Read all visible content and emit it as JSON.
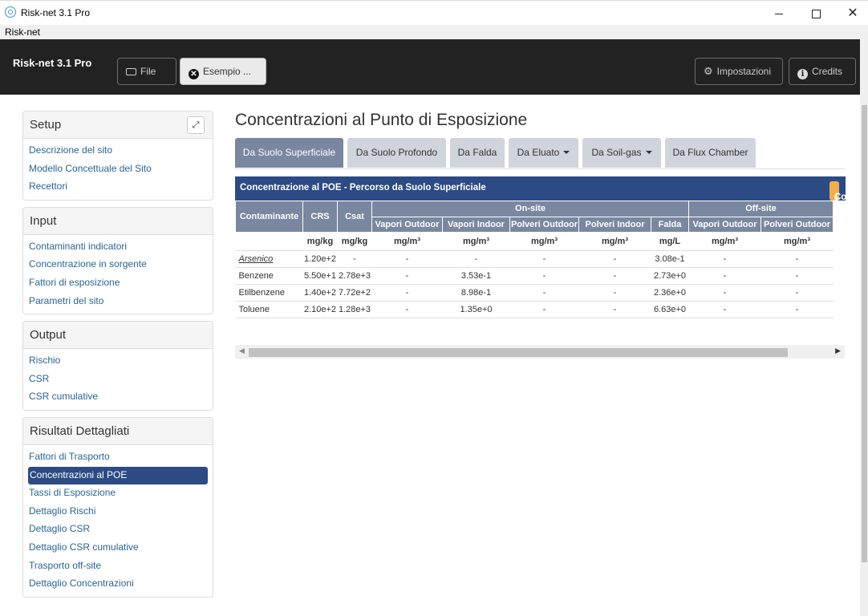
{
  "window": {
    "title": "Risk-net 3.1 Pro",
    "minimize": "—",
    "maximize": "☐",
    "close": "✕"
  },
  "menubar": {
    "label": "Risk-net"
  },
  "navbar": {
    "brand": "Risk-net 3.1 Pro",
    "file_label": "File",
    "esempio_label": "Esempio ...",
    "impostazioni_label": "Impostazioni",
    "credits_label": "Credits"
  },
  "sidebar": {
    "setup": {
      "title": "Setup",
      "items": [
        "Descrizione del sito",
        "Modello Concettuale del Sito",
        "Recettori"
      ]
    },
    "input": {
      "title": "Input",
      "items": [
        "Contaminanti indicatori",
        "Concentrazione in sorgente",
        "Fattori di esposizione",
        "Parametri del sito"
      ]
    },
    "output": {
      "title": "Output",
      "items": [
        "Rischio",
        "CSR",
        "CSR cumulative"
      ]
    },
    "risultati": {
      "title": "Risultati Dettagliati",
      "items": [
        "Fattori di Trasporto",
        "Concentrazioni al POE",
        "Tassi di Esposizione",
        "Dettaglio Rischi",
        "Dettaglio CSR",
        "Dettaglio CSR cumulative",
        "Trasporto off-site",
        "Dettaglio Concentrazioni"
      ],
      "active": "Concentrazioni al POE"
    }
  },
  "main": {
    "title": "Concentrazioni al Punto di Esposizione",
    "tabs": [
      "Da Suolo Superficiale",
      "Da Suolo Profondo",
      "Da Falda",
      "Da Eluato",
      "Da Soil-gas",
      "Da Flux Chamber"
    ],
    "active_tab": "Da Suolo Superficiale",
    "table": {
      "heading": "Concentrazione al POE - Percorso da Suolo Superficiale",
      "copy_label": "Copia tabella",
      "group_onsite": "On-site",
      "group_offsite": "Off-site",
      "col_contaminante": "Contaminante",
      "col_crs": "CRS",
      "col_csat": "Csat",
      "subcols": [
        "Vapori Outdoor",
        "Vapori Indoor",
        "Polveri Outdoor",
        "Polveri Indoor",
        "Falda",
        "Vapori Outdoor",
        "Polveri Outdoor"
      ],
      "units": [
        "mg/kg",
        "mg/kg",
        "mg/m³",
        "mg/m³",
        "mg/m³",
        "mg/m³",
        "mg/L",
        "mg/m³",
        "mg/m³"
      ],
      "rows": [
        {
          "name": "Arsenico",
          "cells": [
            "1.20e+2",
            "-",
            "-",
            "-",
            "-",
            "-",
            "3.08e-1",
            "-",
            "-"
          ]
        },
        {
          "name": "Benzene",
          "cells": [
            "5.50e+1",
            "2.78e+3",
            "-",
            "3.53e-1",
            "-",
            "-",
            "2.73e+0",
            "-",
            "-"
          ]
        },
        {
          "name": "Etilbenzene",
          "cells": [
            "1.40e+2",
            "7.72e+2",
            "-",
            "8.98e-1",
            "-",
            "-",
            "2.36e+0",
            "-",
            "-"
          ]
        },
        {
          "name": "Toluene",
          "cells": [
            "2.10e+2",
            "1.28e+3",
            "-",
            "1.35e+0",
            "-",
            "-",
            "6.63e+0",
            "-",
            "-"
          ]
        }
      ]
    }
  },
  "colors": {
    "navbar": "#222222",
    "primary": "#2c4a84",
    "tab_active": "#7a87a0",
    "tab": "#d0d4dc",
    "copy_button": "#f0ad4e"
  }
}
